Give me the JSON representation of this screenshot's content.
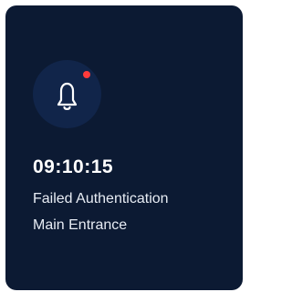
{
  "card": {
    "icon": "bell-icon",
    "has_notification_badge": true,
    "time": "09:10:15",
    "event": "Failed Authentication",
    "location": "Main Entrance"
  },
  "colors": {
    "card_background": "#0c1a33",
    "icon_circle": "#11254a",
    "badge": "#ff3b3b",
    "text_primary": "#ffffff"
  }
}
